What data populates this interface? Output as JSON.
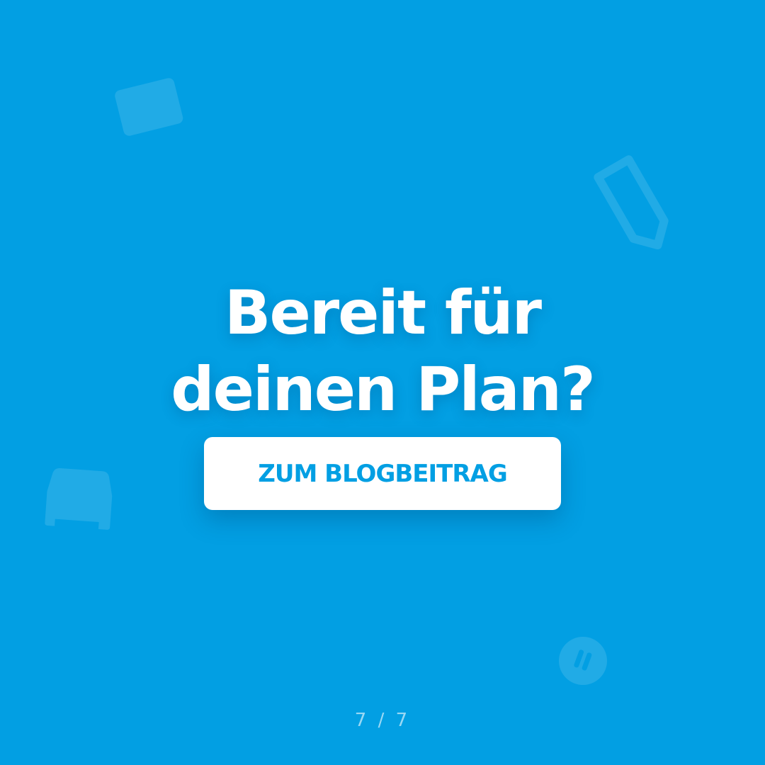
{
  "headline": {
    "line1": "Bereit für",
    "line2": "deinen Plan?"
  },
  "cta": {
    "label": "ZUM BLOGBEITRAG"
  },
  "pagination": {
    "current": "7",
    "separator": "/",
    "total": "7"
  },
  "decorations": [
    {
      "icon": "envelope-icon"
    },
    {
      "icon": "price-tag-icon"
    },
    {
      "icon": "armchair-icon"
    },
    {
      "icon": "coin-icon"
    }
  ],
  "colors": {
    "background": "#029fe3",
    "button_background": "#ffffff",
    "button_text": "#029fe3",
    "headline_text": "#ffffff"
  }
}
